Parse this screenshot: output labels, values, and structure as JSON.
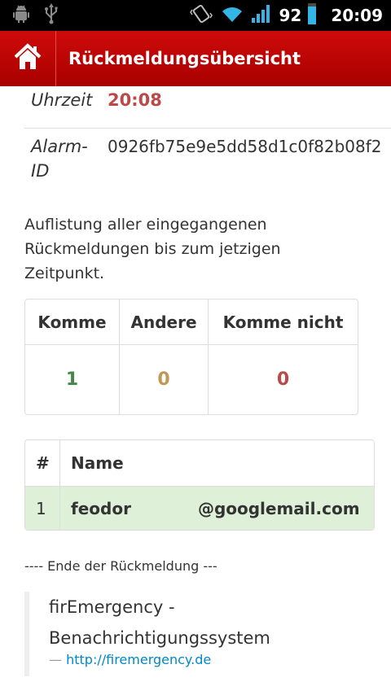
{
  "status_bar": {
    "icons_left": [
      "android-debug-icon",
      "usb-icon"
    ],
    "icons_right": [
      "vibrate-icon",
      "wifi-icon",
      "signal-icon"
    ],
    "battery": "92",
    "time": "20:09"
  },
  "action_bar": {
    "title": "Rückmeldungsübersicht",
    "color": "#c00000"
  },
  "details": {
    "time_label": "Uhrzeit",
    "time_value": "20:08",
    "alarm_label": "Alarm-ID",
    "alarm_value": "0926fb75e9e5dd58d1c0f82b08f2"
  },
  "intro_text": "Auflistung aller eingegangenen Rückmeldungen bis zum jetzigen Zeitpunkt.",
  "summary": {
    "headers": [
      "Komme",
      "Andere",
      "Komme nicht"
    ],
    "values": [
      "1",
      "0",
      "0"
    ]
  },
  "names_table": {
    "headers": [
      "#",
      "Name"
    ],
    "rows": [
      {
        "index": "1",
        "name_start": "feodor",
        "name_end": "@googlemail.com"
      }
    ]
  },
  "end_note": "---- Ende der Rückmeldung ---",
  "quote": {
    "text": "firEmergency - Benachrichtigungssystem",
    "dash": "—",
    "link": "http://firemergency.de"
  }
}
